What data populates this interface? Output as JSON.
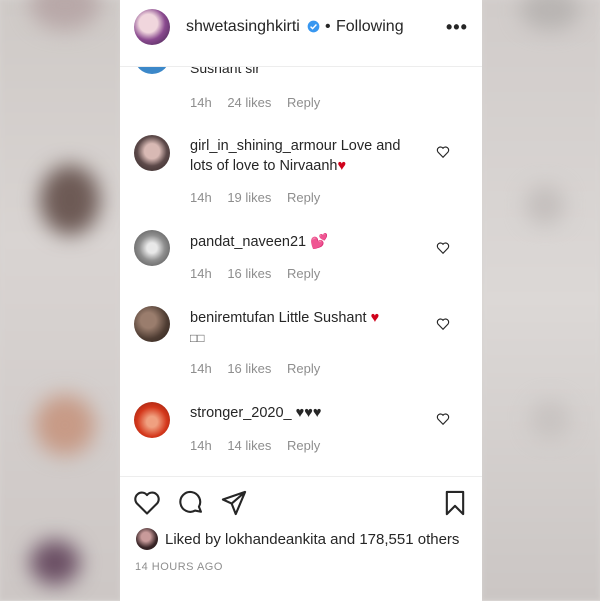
{
  "header": {
    "username": "shwetasinghkirti",
    "dot": "•",
    "follow_status": "Following",
    "more_label": "•••"
  },
  "partial_comment": {
    "text": "Sushant sir",
    "time": "14h",
    "likes": "24 likes",
    "reply": "Reply"
  },
  "comments": [
    {
      "username": "girl_in_shining_armour",
      "text": "Love and lots of love to Nirvaanh",
      "emoji": "♥",
      "time": "14h",
      "likes": "19 likes",
      "reply": "Reply"
    },
    {
      "username": "pandat_naveen21",
      "text": "",
      "emoji": "💕",
      "time": "14h",
      "likes": "16 likes",
      "reply": "Reply"
    },
    {
      "username": "beniremtufan",
      "text": "Little Sushant",
      "emoji": "♥",
      "extra": "□□",
      "time": "14h",
      "likes": "16 likes",
      "reply": "Reply"
    },
    {
      "username": "stronger_2020_",
      "text": "",
      "emoji": "♥♥♥",
      "time": "14h",
      "likes": "14 likes",
      "reply": "Reply"
    }
  ],
  "likes": {
    "prefix": "Liked by",
    "user": "lokhandeankita",
    "and": "and",
    "others": "178,551 others"
  },
  "timestamp": "14 HOURS AGO",
  "colors": {
    "text": "#262626",
    "muted": "#8e8e8e",
    "heart_red": "#d0021b",
    "verified_blue": "#3897f0"
  }
}
